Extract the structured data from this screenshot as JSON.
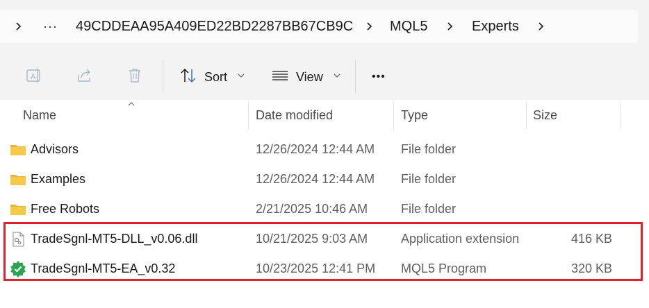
{
  "breadcrumb": {
    "overflow_label": "···",
    "items": [
      "49CDDEAA95A409ED22BD2287BB67CB9C",
      "MQL5",
      "Experts"
    ]
  },
  "toolbar": {
    "sort_label": "Sort",
    "view_label": "View",
    "more_label": "•••"
  },
  "columns": {
    "name": "Name",
    "date": "Date modified",
    "type": "Type",
    "size": "Size"
  },
  "files": [
    {
      "name": "Advisors",
      "date": "12/26/2024 12:44 AM",
      "type": "File folder",
      "size": "",
      "icon": "folder-icon"
    },
    {
      "name": "Examples",
      "date": "12/26/2024 12:44 AM",
      "type": "File folder",
      "size": "",
      "icon": "folder-icon"
    },
    {
      "name": "Free Robots",
      "date": "2/21/2025 10:46 AM",
      "type": "File folder",
      "size": "",
      "icon": "folder-icon"
    },
    {
      "name": "TradeSgnl-MT5-DLL_v0.06.dll",
      "date": "10/21/2025 9:03 AM",
      "type": "Application extension",
      "size": "416 KB",
      "icon": "dll-file-icon"
    },
    {
      "name": "TradeSgnl-MT5-EA_v0.32",
      "date": "10/23/2025 12:41 PM",
      "type": "MQL5 Program",
      "size": "320 KB",
      "icon": "mql5-program-icon"
    }
  ],
  "colors": {
    "highlight": "#e0202d",
    "folder": "#f7c948",
    "mql5_green": "#2aa44f"
  }
}
